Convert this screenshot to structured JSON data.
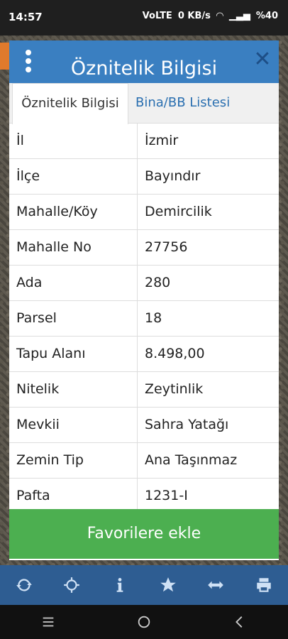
{
  "status": {
    "time": "14:57",
    "signal": "VoLTE",
    "net_speed": "0 KB/s",
    "battery": "%40"
  },
  "dialog": {
    "title": "Öznitelik Bilgisi",
    "tabs": [
      {
        "label": "Öznitelik Bilgisi"
      },
      {
        "label": "Bina/BB Listesi"
      }
    ],
    "rows": [
      {
        "key": "İl",
        "value": "İzmir"
      },
      {
        "key": "İlçe",
        "value": "Bayındır"
      },
      {
        "key": "Mahalle/Köy",
        "value": "Demircilik"
      },
      {
        "key": "Mahalle No",
        "value": "27756"
      },
      {
        "key": "Ada",
        "value": "280"
      },
      {
        "key": "Parsel",
        "value": "18"
      },
      {
        "key": "Tapu Alanı",
        "value": "8.498,00"
      },
      {
        "key": "Nitelik",
        "value": "Zeytinlik"
      },
      {
        "key": "Mevkii",
        "value": "Sahra Yatağı"
      },
      {
        "key": "Zemin Tip",
        "value": "Ana Taşınmaz"
      },
      {
        "key": "Pafta",
        "value": "1231-I"
      }
    ],
    "favorite_button": "Favorilere ekle"
  },
  "toolbar_icons": [
    "refresh-icon",
    "crosshair-icon",
    "info-icon",
    "star-icon",
    "swap-arrows-icon",
    "print-icon"
  ],
  "colors": {
    "header": "#3a7fc1",
    "button": "#4caf50",
    "toolbar": "#2e5d92"
  }
}
